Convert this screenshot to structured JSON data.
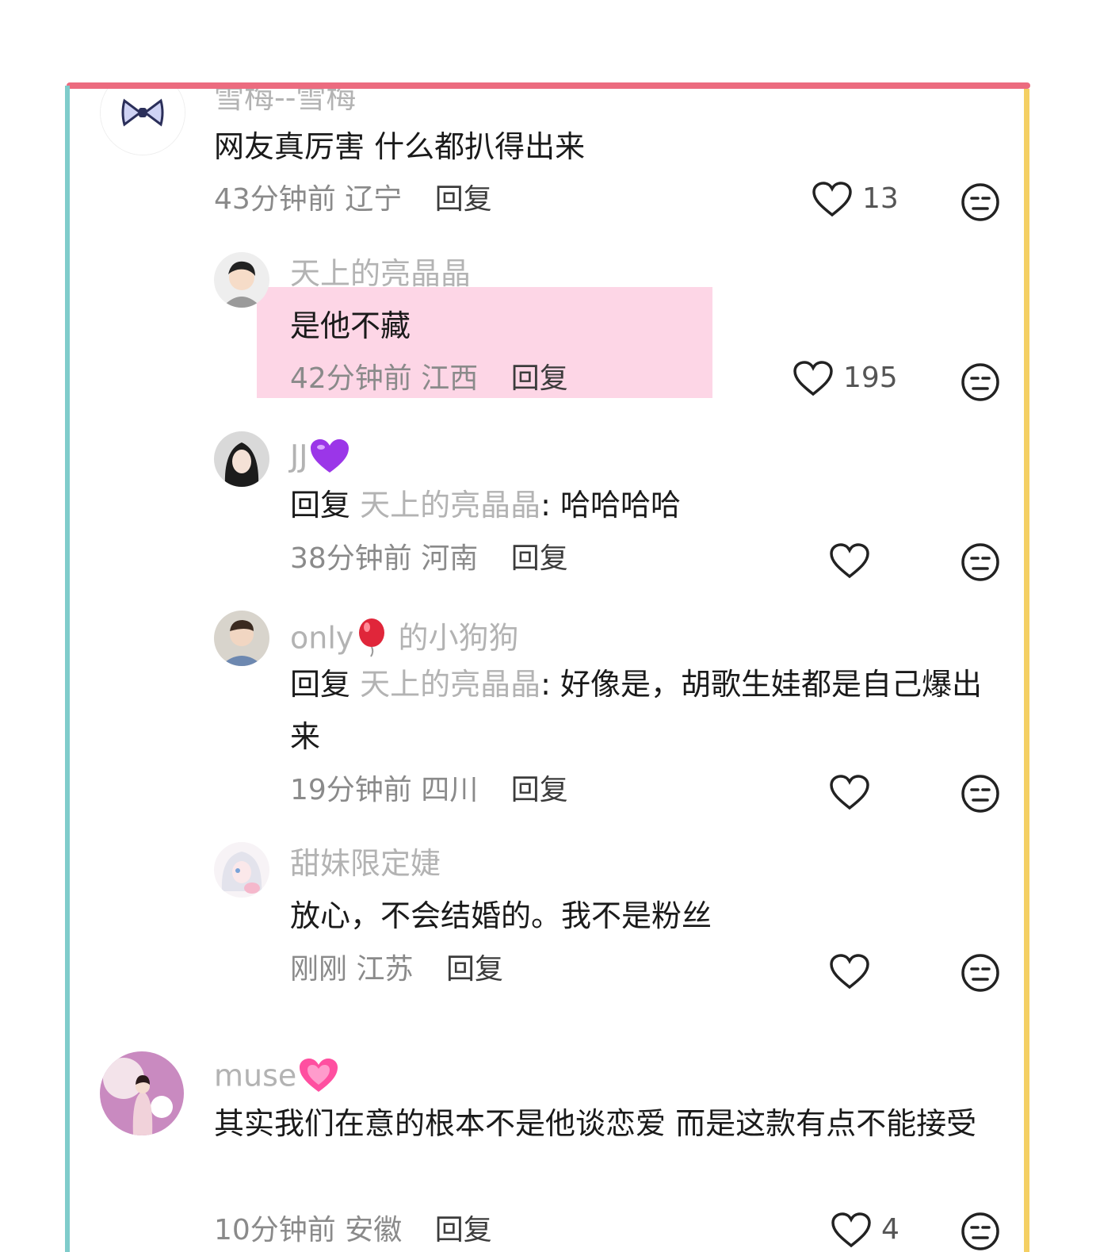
{
  "comments": [
    {
      "username": "雪梅--雪梅",
      "text": "网友真厉害 什么都扒得出来",
      "time": "43分钟前",
      "location": "辽宁",
      "reply_label": "回复",
      "likes": "13",
      "avatar": "bow-icon"
    },
    {
      "username": "天上的亮晶晶",
      "text": "是他不藏",
      "time": "42分钟前",
      "location": "江西",
      "reply_label": "回复",
      "likes": "195",
      "highlight_color": "#fdd6e6"
    },
    {
      "username": "JJ",
      "username_emoji": "purple-heart-icon",
      "reply_prefix": "回复",
      "reply_target": "天上的亮晶晶",
      "text": ": 哈哈哈哈",
      "time": "38分钟前",
      "location": "河南",
      "reply_label": "回复"
    },
    {
      "username": "only",
      "username_emoji": "balloon-icon",
      "username_suffix": "的小狗狗",
      "reply_prefix": "回复",
      "reply_target": "天上的亮晶晶",
      "text": ": 好像是，胡歌生娃都是自己爆出来",
      "time": "19分钟前",
      "location": "四川",
      "reply_label": "回复"
    },
    {
      "username": "甜妹限定婕",
      "text": "放心，不会结婚的。我不是粉丝",
      "time": "刚刚",
      "location": "江苏",
      "reply_label": "回复"
    },
    {
      "username": "muse",
      "username_emoji": "sparkling-heart-icon",
      "text": "其实我们在意的根本不是他谈恋爱 而是这款有点不能接受",
      "time": "10分钟前",
      "location": "安徽",
      "reply_label": "回复",
      "likes": "4"
    }
  ],
  "colors": {
    "frame_top": "#ec6b7f",
    "frame_left": "#7fcccb",
    "frame_right": "#f4cf63",
    "username": "#b3b3b3",
    "highlight": "#fdd6e6"
  }
}
